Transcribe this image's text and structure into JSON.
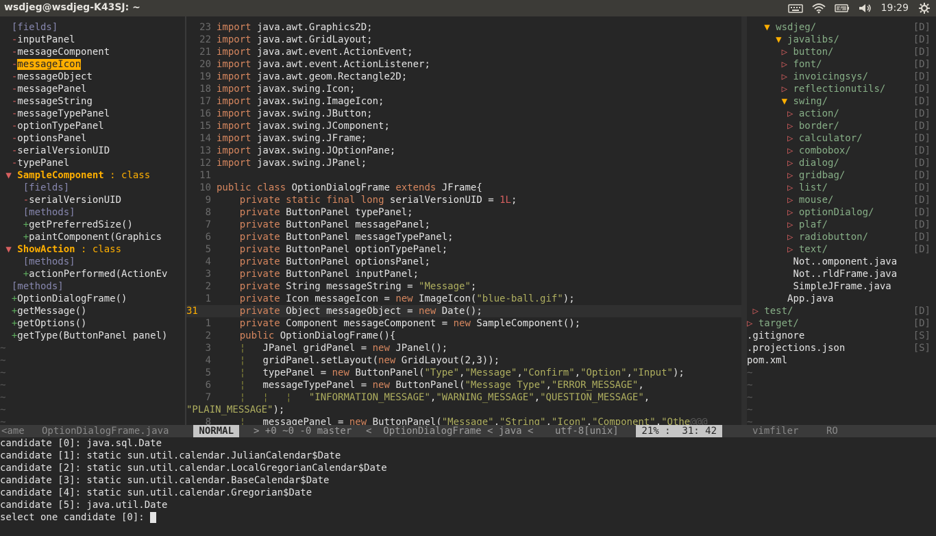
{
  "topbar": {
    "title": "wsdjeg@wsdjeg-K43SJ: ~",
    "clock": "19:29",
    "icons": [
      "keyboard-icon",
      "wifi-icon",
      "battery-icon",
      "volume-icon",
      "gear-icon"
    ]
  },
  "outline": [
    {
      "prefix": "  ",
      "text": "[fields]",
      "kind": "grp"
    },
    {
      "prefix": "  -",
      "text": "inputPanel",
      "kind": "item"
    },
    {
      "prefix": "  -",
      "text": "messageComponent",
      "kind": "item"
    },
    {
      "prefix": "  -",
      "text": "messageIcon",
      "kind": "item",
      "selected": true
    },
    {
      "prefix": "  -",
      "text": "messageObject",
      "kind": "item"
    },
    {
      "prefix": "  -",
      "text": "messagePanel",
      "kind": "item"
    },
    {
      "prefix": "  -",
      "text": "messageString",
      "kind": "item"
    },
    {
      "prefix": "  -",
      "text": "messageTypePanel",
      "kind": "item"
    },
    {
      "prefix": "  -",
      "text": "optionTypePanel",
      "kind": "item"
    },
    {
      "prefix": "  -",
      "text": "optionsPanel",
      "kind": "item"
    },
    {
      "prefix": "  -",
      "text": "serialVersionUID",
      "kind": "item"
    },
    {
      "prefix": "  -",
      "text": "typePanel",
      "kind": "item"
    },
    {
      "prefix": " ▼ ",
      "text": "SampleComponent",
      "kind": "class",
      "suffix": " : class"
    },
    {
      "prefix": "    ",
      "text": "[fields]",
      "kind": "grp"
    },
    {
      "prefix": "    -",
      "text": "serialVersionUID",
      "kind": "item"
    },
    {
      "prefix": "    ",
      "text": "[methods]",
      "kind": "grp"
    },
    {
      "prefix": "    +",
      "text": "getPreferredSize()",
      "kind": "item"
    },
    {
      "prefix": "    +",
      "text": "paintComponent(Graphics",
      "kind": "item"
    },
    {
      "prefix": " ▼ ",
      "text": "ShowAction",
      "kind": "class",
      "suffix": " : class"
    },
    {
      "prefix": "    ",
      "text": "[methods]",
      "kind": "grp"
    },
    {
      "prefix": "    +",
      "text": "actionPerformed(ActionEv",
      "kind": "item"
    },
    {
      "prefix": "  ",
      "text": "[methods]",
      "kind": "grp"
    },
    {
      "prefix": "  +",
      "text": "OptionDialogFrame()",
      "kind": "item"
    },
    {
      "prefix": "  +",
      "text": "getMessage()",
      "kind": "item"
    },
    {
      "prefix": "  +",
      "text": "getOptions()",
      "kind": "item"
    },
    {
      "prefix": "  +",
      "text": "getType(ButtonPanel panel)",
      "kind": "item"
    }
  ],
  "code": [
    {
      "n": "23",
      "html": "<span class='k'>import</span> java.awt.Graphics2D;"
    },
    {
      "n": "22",
      "html": "<span class='k'>import</span> java.awt.GridLayout;"
    },
    {
      "n": "21",
      "html": "<span class='k'>import</span> java.awt.event.ActionEvent;"
    },
    {
      "n": "20",
      "html": "<span class='k'>import</span> java.awt.event.ActionListener;"
    },
    {
      "n": "19",
      "html": "<span class='k'>import</span> java.awt.geom.Rectangle2D;"
    },
    {
      "n": "18",
      "html": "<span class='k'>import</span> javax.swing.Icon;"
    },
    {
      "n": "17",
      "html": "<span class='k'>import</span> javax.swing.ImageIcon;"
    },
    {
      "n": "16",
      "html": "<span class='k'>import</span> javax.swing.JButton;"
    },
    {
      "n": "15",
      "html": "<span class='k'>import</span> javax.swing.JComponent;"
    },
    {
      "n": "14",
      "html": "<span class='k'>import</span> javax.swing.JFrame;"
    },
    {
      "n": "13",
      "html": "<span class='k'>import</span> javax.swing.JOptionPane;"
    },
    {
      "n": "12",
      "html": "<span class='k'>import</span> javax.swing.JPanel;"
    },
    {
      "n": "11",
      "html": ""
    },
    {
      "n": "10",
      "html": "<span class='k'>public</span> <span class='k'>class</span> OptionDialogFrame <span class='k'>extends</span> JFrame{"
    },
    {
      "n": "9",
      "html": "    <span class='k'>private</span> <span class='k'>static</span> <span class='k'>final</span> <span class='k'>long</span> serialVersionUID = <span class='n'>1L</span>;"
    },
    {
      "n": "8",
      "html": "    <span class='k'>private</span> ButtonPanel typePanel;"
    },
    {
      "n": "7",
      "html": "    <span class='k'>private</span> ButtonPanel messagePanel;"
    },
    {
      "n": "6",
      "html": "    <span class='k'>private</span> ButtonPanel messageTypePanel;"
    },
    {
      "n": "5",
      "html": "    <span class='k'>private</span> ButtonPanel optionTypePanel;"
    },
    {
      "n": "4",
      "html": "    <span class='k'>private</span> ButtonPanel optionsPanel;"
    },
    {
      "n": "3",
      "html": "    <span class='k'>private</span> ButtonPanel inputPanel;"
    },
    {
      "n": "2",
      "html": "    <span class='k'>private</span> String messageString = <span class='s'>\"Message\"</span>;"
    },
    {
      "n": "1",
      "html": "    <span class='k'>private</span> Icon messageIcon = <span class='k'>new</span> ImageIcon(<span class='s'>\"blue-ball.gif\"</span>);"
    },
    {
      "n": "31",
      "cur": true,
      "html": "    <span class='k'>private</span> Object messageObject = <span class='k'>new</span> Date();"
    },
    {
      "n": "1",
      "html": "    <span class='k'>private</span> Component messageComponent = <span class='k'>new</span> SampleComponent();"
    },
    {
      "n": "2",
      "html": "    <span class='k'>public</span> OptionDialogFrame(){"
    },
    {
      "n": "3",
      "html": "    <span class='guide'>¦</span>   JPanel gridPanel = <span class='k'>new</span> JPanel();"
    },
    {
      "n": "4",
      "html": "    <span class='guide'>¦</span>   gridPanel.setLayout(<span class='k'>new</span> GridLayout(2,3));"
    },
    {
      "n": "5",
      "html": "    <span class='guide'>¦</span>   typePanel = <span class='k'>new</span> ButtonPanel(<span class='s'>\"Type\"</span>,<span class='s'>\"Message\"</span>,<span class='s'>\"Confirm\"</span>,<span class='s'>\"Option\"</span>,<span class='s'>\"Input\"</span>);"
    },
    {
      "n": "6",
      "html": "    <span class='guide'>¦</span>   messageTypePanel = <span class='k'>new</span> ButtonPanel(<span class='s'>\"Message Type\"</span>,<span class='s'>\"ERROR_MESSAGE\"</span>,"
    },
    {
      "n": "7",
      "html": "    <span class='guide'>¦   ¦   ¦</span>   <span class='s'>\"INFORMATION_MESSAGE\"</span>,<span class='s'>\"WARNING_MESSAGE\"</span>,<span class='s'>\"QUESTION_MESSAGE\"</span>,"
    },
    {
      "n": "",
      "html": "<span class='s'>\"PLAIN_MESSAGE\"</span>);",
      "wrap": true
    },
    {
      "n": "8",
      "html": "    <span class='guide'>¦</span>   messagePanel = <span class='k'>new</span> ButtonPanel(<span class='s'>\"Message\"</span>,<span class='s'>\"String\"</span>,<span class='s'>\"Icon\"</span>,<span class='s'>\"Component\"</span>,<span class='s'>\"Othe</span><span class='tilde'>@@@</span>"
    }
  ],
  "files": [
    {
      "indent": "   ",
      "arrow": "▼ ",
      "name": "wsdjeg/",
      "tag": "[D]",
      "type": "open"
    },
    {
      "indent": "     ",
      "arrow": "▼ ",
      "name": "javalibs/",
      "tag": "[D]",
      "type": "open"
    },
    {
      "indent": "      ",
      "arrow": "▷ ",
      "name": "button/",
      "tag": "[D]",
      "type": "closed"
    },
    {
      "indent": "      ",
      "arrow": "▷ ",
      "name": "font/",
      "tag": "[D]",
      "type": "closed"
    },
    {
      "indent": "      ",
      "arrow": "▷ ",
      "name": "invoicingsys/",
      "tag": "[D]",
      "type": "closed"
    },
    {
      "indent": "      ",
      "arrow": "▷ ",
      "name": "reflectionutils/",
      "tag": "[D]",
      "type": "closed"
    },
    {
      "indent": "      ",
      "arrow": "▼ ",
      "name": "swing/",
      "tag": "[D]",
      "type": "open"
    },
    {
      "indent": "       ",
      "arrow": "▷ ",
      "name": "action/",
      "tag": "[D]",
      "type": "closed"
    },
    {
      "indent": "       ",
      "arrow": "▷ ",
      "name": "border/",
      "tag": "[D]",
      "type": "closed"
    },
    {
      "indent": "       ",
      "arrow": "▷ ",
      "name": "calculator/",
      "tag": "[D]",
      "type": "closed"
    },
    {
      "indent": "       ",
      "arrow": "▷ ",
      "name": "combobox/",
      "tag": "[D]",
      "type": "closed"
    },
    {
      "indent": "       ",
      "arrow": "▷ ",
      "name": "dialog/",
      "tag": "[D]",
      "type": "closed"
    },
    {
      "indent": "       ",
      "arrow": "▷ ",
      "name": "gridbag/",
      "tag": "[D]",
      "type": "closed"
    },
    {
      "indent": "       ",
      "arrow": "▷ ",
      "name": "list/",
      "tag": "[D]",
      "type": "closed"
    },
    {
      "indent": "       ",
      "arrow": "▷ ",
      "name": "mouse/",
      "tag": "[D]",
      "type": "closed"
    },
    {
      "indent": "       ",
      "arrow": "▷ ",
      "name": "optionDialog/",
      "tag": "[D]",
      "type": "closed"
    },
    {
      "indent": "       ",
      "arrow": "▷ ",
      "name": "plaf/",
      "tag": "[D]",
      "type": "closed"
    },
    {
      "indent": "       ",
      "arrow": "▷ ",
      "name": "radiobutton/",
      "tag": "[D]",
      "type": "closed"
    },
    {
      "indent": "       ",
      "arrow": "▷ ",
      "name": "text/",
      "tag": "[D]",
      "type": "closed"
    },
    {
      "indent": "        ",
      "arrow": "",
      "name": "Not..omponent.java",
      "tag": "",
      "type": "file"
    },
    {
      "indent": "        ",
      "arrow": "",
      "name": "Not..rldFrame.java",
      "tag": "",
      "type": "file"
    },
    {
      "indent": "        ",
      "arrow": "",
      "name": "SimpleJFrame.java",
      "tag": "",
      "type": "file"
    },
    {
      "indent": "       ",
      "arrow": "",
      "name": "App.java",
      "tag": "",
      "type": "file"
    },
    {
      "indent": " ",
      "arrow": "▷ ",
      "name": "test/",
      "tag": "[D]",
      "type": "closed"
    },
    {
      "indent": "",
      "arrow": "▷ ",
      "name": "target/",
      "tag": "[D]",
      "type": "closed"
    },
    {
      "indent": "",
      "arrow": "",
      "name": ".gitignore",
      "tag": "[S]",
      "type": "file"
    },
    {
      "indent": "",
      "arrow": "",
      "name": ".projections.json",
      "tag": "[S]",
      "type": "file"
    },
    {
      "indent": "",
      "arrow": "",
      "name": "pom.xml",
      "tag": "",
      "type": "file"
    }
  ],
  "statusline": {
    "left": "<ame   OptionDialogFrame.java",
    "mode": " NORMAL ",
    "git": "> +0 ~0 -0 master",
    "arrow1": ">",
    "func": "<  OptionDialogFrame < java <",
    "enc": "utf-8[unix]",
    "arrow2": "<",
    "pos": " 21% :  31: 42 ",
    "right_name": "vimfiler",
    "right_ro": "RO"
  },
  "cmdline": [
    "candidate [0]: java.sql.Date",
    "candidate [1]: static sun.util.calendar.JulianCalendar$Date",
    "candidate [2]: static sun.util.calendar.LocalGregorianCalendar$Date",
    "candidate [3]: static sun.util.calendar.BaseCalendar$Date",
    "candidate [4]: static sun.util.calendar.Gregorian$Date",
    "candidate [5]: java.util.Date"
  ],
  "prompt": "select one candidate [0]: "
}
